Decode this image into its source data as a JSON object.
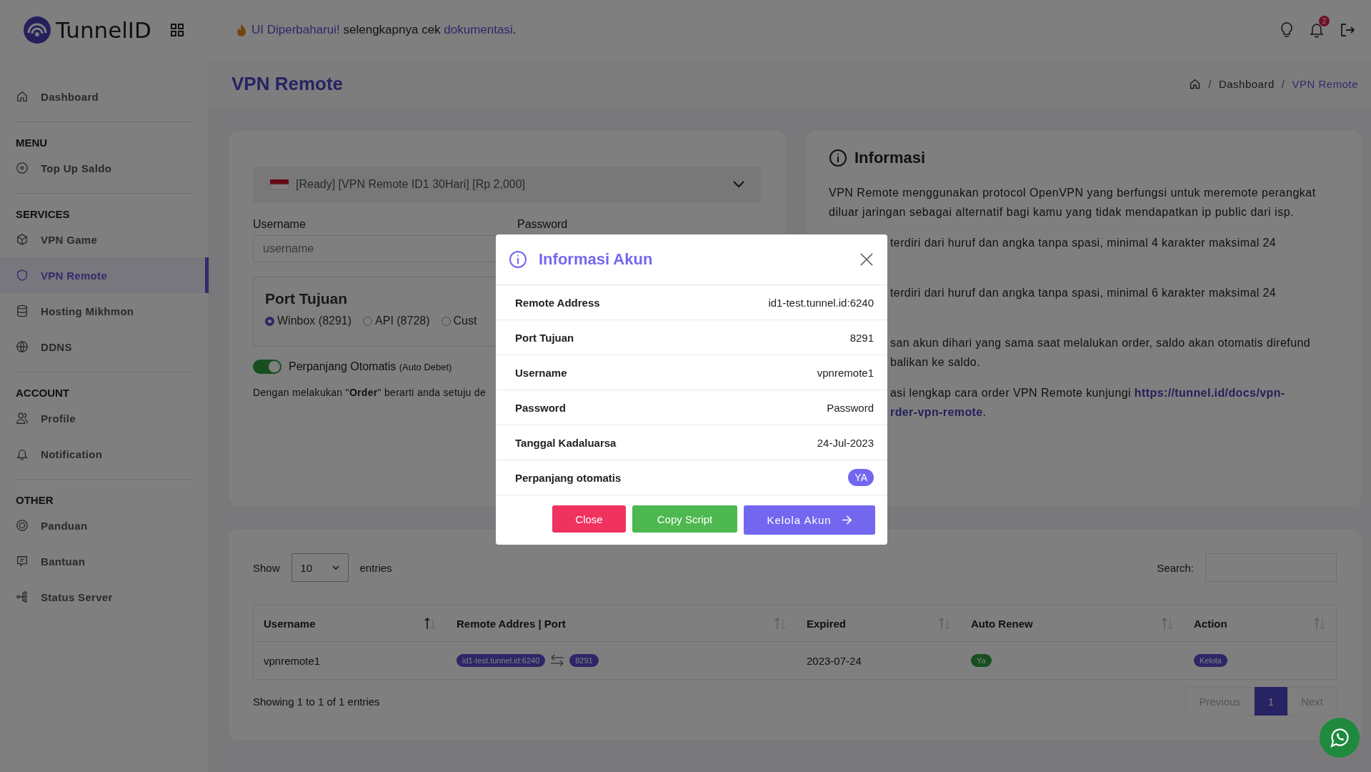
{
  "brand": {
    "name": "TunnelID"
  },
  "announcement": {
    "highlight": "UI Diperbaharui!",
    "text": "selengkapnya cek",
    "link": "dokumentasi",
    "end": "."
  },
  "header": {
    "notification_count": "2"
  },
  "sidebar": {
    "groups": [
      {
        "items": [
          {
            "label": "Dashboard",
            "selected": false
          }
        ]
      },
      {
        "heading": "MENU",
        "items": [
          {
            "label": "Top Up Saldo",
            "selected": false
          }
        ]
      },
      {
        "heading": "SERVICES",
        "items": [
          {
            "label": "VPN Game",
            "selected": false
          },
          {
            "label": "VPN Remote",
            "selected": true
          },
          {
            "label": "Hosting Mikhmon",
            "selected": false
          },
          {
            "label": "DDNS",
            "selected": false
          }
        ]
      },
      {
        "heading": "ACCOUNT",
        "items": [
          {
            "label": "Profile",
            "selected": false
          },
          {
            "label": "Notification",
            "selected": false
          }
        ]
      },
      {
        "heading": "OTHER",
        "items": [
          {
            "label": "Panduan",
            "selected": false
          },
          {
            "label": "Bantuan",
            "selected": false
          },
          {
            "label": "Status Server",
            "selected": false
          }
        ]
      }
    ]
  },
  "page": {
    "title": "VPN Remote",
    "breadcrumb": [
      {
        "label": "Dashboard",
        "selected": false
      },
      {
        "label": "VPN Remote",
        "selected": true
      }
    ],
    "separators": [
      "/",
      "/"
    ]
  },
  "order_form": {
    "package": "[Ready] [VPN Remote ID1 30Hari] [Rp 2,000]",
    "username_label": "Username",
    "username_placeholder": "username",
    "password_label": "Password",
    "port_title": "Port Tujuan",
    "ports": [
      {
        "label": "Winbox (8291)",
        "selected": true
      },
      {
        "label": "API (8728)",
        "selected": false
      },
      {
        "label": "Cust",
        "selected": false
      }
    ],
    "auto_renew": {
      "on": true,
      "label": "Perpanjang Otomatis",
      "note": "(Auto Debet)"
    },
    "terms": "Dengan melakukan \"**Order**\" berarti anda setuju de"
  },
  "info": {
    "title": "Informasi",
    "intro": "VPN Remote menggunakan protocol OpenVPN yang berfungsi untuk meremote perangkat diluar jaringan sebagai alternatif bagi kamu yang tidak mendapatkan ip public dari isp.",
    "fragments": [
      {
        "lines": [
          "terdiri dari huruf dan angka tanpa spasi, minimal 4 karakter maksimal 24"
        ]
      },
      {
        "lines": [
          "terdiri dari huruf dan angka tanpa spasi, minimal 6 karakter maksimal 24"
        ]
      },
      {
        "lines": [
          "san akun dihari yang sama saat melalukan order, saldo akan otomatis direfund",
          "balikan ke saldo."
        ]
      },
      {
        "lines": [
          "asi lengkap cara order VPN Remote kunjungi "
        ],
        "link": "https://tunnel.id/docs/vpn-",
        "link_rest": "rder-vpn-remote",
        "end": "."
      }
    ]
  },
  "table": {
    "show_label": "Show",
    "page_size": "10",
    "entries_label": "entries",
    "search_label": "Search:",
    "columns": [
      "Username",
      "Remote Addres | Port",
      "Expired",
      "Auto Renew",
      "Action"
    ],
    "rows": [
      {
        "username": "vpnremote1",
        "address": "id1-test.tunnel.id:6240",
        "port": "8291",
        "expired": "2023-07-24",
        "auto_renew": "Ya",
        "action": "Kelola"
      }
    ],
    "summary": "Showing 1 to 1 of 1 entries",
    "pagination": [
      {
        "label": "Previous",
        "disabled": true,
        "selected": false
      },
      {
        "label": "1",
        "disabled": false,
        "selected": true
      },
      {
        "label": "Next",
        "disabled": true,
        "selected": false
      }
    ]
  },
  "modal": {
    "title": "Informasi Akun",
    "rows": [
      {
        "label": "Remote Address",
        "value": "id1-test.tunnel.id:6240",
        "kind": "text"
      },
      {
        "label": "Port Tujuan",
        "value": "8291",
        "kind": "text"
      },
      {
        "label": "Username",
        "value": "vpnremote1",
        "kind": "text"
      },
      {
        "label": "Password",
        "value": "Password",
        "kind": "text"
      },
      {
        "label": "Tanggal Kadaluarsa",
        "value": "24-Jul-2023",
        "kind": "text"
      },
      {
        "label": "Perpanjang otomatis",
        "value": "YA",
        "kind": "badge"
      }
    ],
    "buttons": [
      {
        "label": "Close",
        "kind": "close"
      },
      {
        "label": "Copy Script",
        "kind": "copy"
      },
      {
        "label": "Kelola Akun",
        "kind": "manage"
      }
    ]
  }
}
